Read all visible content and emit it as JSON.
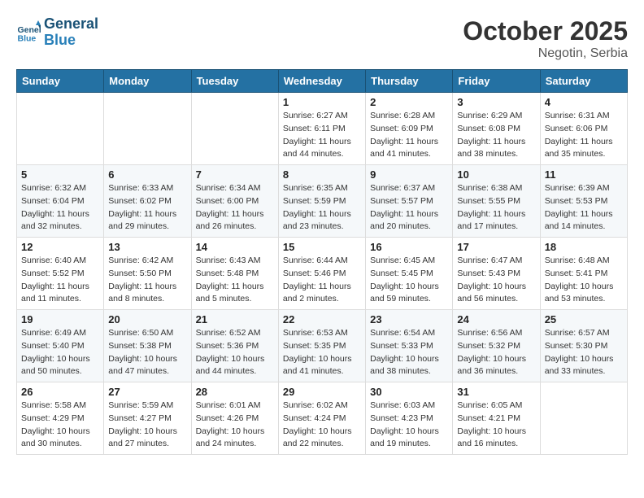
{
  "header": {
    "logo_line1": "General",
    "logo_line2": "Blue",
    "month": "October 2025",
    "location": "Negotin, Serbia"
  },
  "weekdays": [
    "Sunday",
    "Monday",
    "Tuesday",
    "Wednesday",
    "Thursday",
    "Friday",
    "Saturday"
  ],
  "weeks": [
    [
      {
        "day": "",
        "info": ""
      },
      {
        "day": "",
        "info": ""
      },
      {
        "day": "",
        "info": ""
      },
      {
        "day": "1",
        "info": "Sunrise: 6:27 AM\nSunset: 6:11 PM\nDaylight: 11 hours\nand 44 minutes."
      },
      {
        "day": "2",
        "info": "Sunrise: 6:28 AM\nSunset: 6:09 PM\nDaylight: 11 hours\nand 41 minutes."
      },
      {
        "day": "3",
        "info": "Sunrise: 6:29 AM\nSunset: 6:08 PM\nDaylight: 11 hours\nand 38 minutes."
      },
      {
        "day": "4",
        "info": "Sunrise: 6:31 AM\nSunset: 6:06 PM\nDaylight: 11 hours\nand 35 minutes."
      }
    ],
    [
      {
        "day": "5",
        "info": "Sunrise: 6:32 AM\nSunset: 6:04 PM\nDaylight: 11 hours\nand 32 minutes."
      },
      {
        "day": "6",
        "info": "Sunrise: 6:33 AM\nSunset: 6:02 PM\nDaylight: 11 hours\nand 29 minutes."
      },
      {
        "day": "7",
        "info": "Sunrise: 6:34 AM\nSunset: 6:00 PM\nDaylight: 11 hours\nand 26 minutes."
      },
      {
        "day": "8",
        "info": "Sunrise: 6:35 AM\nSunset: 5:59 PM\nDaylight: 11 hours\nand 23 minutes."
      },
      {
        "day": "9",
        "info": "Sunrise: 6:37 AM\nSunset: 5:57 PM\nDaylight: 11 hours\nand 20 minutes."
      },
      {
        "day": "10",
        "info": "Sunrise: 6:38 AM\nSunset: 5:55 PM\nDaylight: 11 hours\nand 17 minutes."
      },
      {
        "day": "11",
        "info": "Sunrise: 6:39 AM\nSunset: 5:53 PM\nDaylight: 11 hours\nand 14 minutes."
      }
    ],
    [
      {
        "day": "12",
        "info": "Sunrise: 6:40 AM\nSunset: 5:52 PM\nDaylight: 11 hours\nand 11 minutes."
      },
      {
        "day": "13",
        "info": "Sunrise: 6:42 AM\nSunset: 5:50 PM\nDaylight: 11 hours\nand 8 minutes."
      },
      {
        "day": "14",
        "info": "Sunrise: 6:43 AM\nSunset: 5:48 PM\nDaylight: 11 hours\nand 5 minutes."
      },
      {
        "day": "15",
        "info": "Sunrise: 6:44 AM\nSunset: 5:46 PM\nDaylight: 11 hours\nand 2 minutes."
      },
      {
        "day": "16",
        "info": "Sunrise: 6:45 AM\nSunset: 5:45 PM\nDaylight: 10 hours\nand 59 minutes."
      },
      {
        "day": "17",
        "info": "Sunrise: 6:47 AM\nSunset: 5:43 PM\nDaylight: 10 hours\nand 56 minutes."
      },
      {
        "day": "18",
        "info": "Sunrise: 6:48 AM\nSunset: 5:41 PM\nDaylight: 10 hours\nand 53 minutes."
      }
    ],
    [
      {
        "day": "19",
        "info": "Sunrise: 6:49 AM\nSunset: 5:40 PM\nDaylight: 10 hours\nand 50 minutes."
      },
      {
        "day": "20",
        "info": "Sunrise: 6:50 AM\nSunset: 5:38 PM\nDaylight: 10 hours\nand 47 minutes."
      },
      {
        "day": "21",
        "info": "Sunrise: 6:52 AM\nSunset: 5:36 PM\nDaylight: 10 hours\nand 44 minutes."
      },
      {
        "day": "22",
        "info": "Sunrise: 6:53 AM\nSunset: 5:35 PM\nDaylight: 10 hours\nand 41 minutes."
      },
      {
        "day": "23",
        "info": "Sunrise: 6:54 AM\nSunset: 5:33 PM\nDaylight: 10 hours\nand 38 minutes."
      },
      {
        "day": "24",
        "info": "Sunrise: 6:56 AM\nSunset: 5:32 PM\nDaylight: 10 hours\nand 36 minutes."
      },
      {
        "day": "25",
        "info": "Sunrise: 6:57 AM\nSunset: 5:30 PM\nDaylight: 10 hours\nand 33 minutes."
      }
    ],
    [
      {
        "day": "26",
        "info": "Sunrise: 5:58 AM\nSunset: 4:29 PM\nDaylight: 10 hours\nand 30 minutes."
      },
      {
        "day": "27",
        "info": "Sunrise: 5:59 AM\nSunset: 4:27 PM\nDaylight: 10 hours\nand 27 minutes."
      },
      {
        "day": "28",
        "info": "Sunrise: 6:01 AM\nSunset: 4:26 PM\nDaylight: 10 hours\nand 24 minutes."
      },
      {
        "day": "29",
        "info": "Sunrise: 6:02 AM\nSunset: 4:24 PM\nDaylight: 10 hours\nand 22 minutes."
      },
      {
        "day": "30",
        "info": "Sunrise: 6:03 AM\nSunset: 4:23 PM\nDaylight: 10 hours\nand 19 minutes."
      },
      {
        "day": "31",
        "info": "Sunrise: 6:05 AM\nSunset: 4:21 PM\nDaylight: 10 hours\nand 16 minutes."
      },
      {
        "day": "",
        "info": ""
      }
    ]
  ]
}
